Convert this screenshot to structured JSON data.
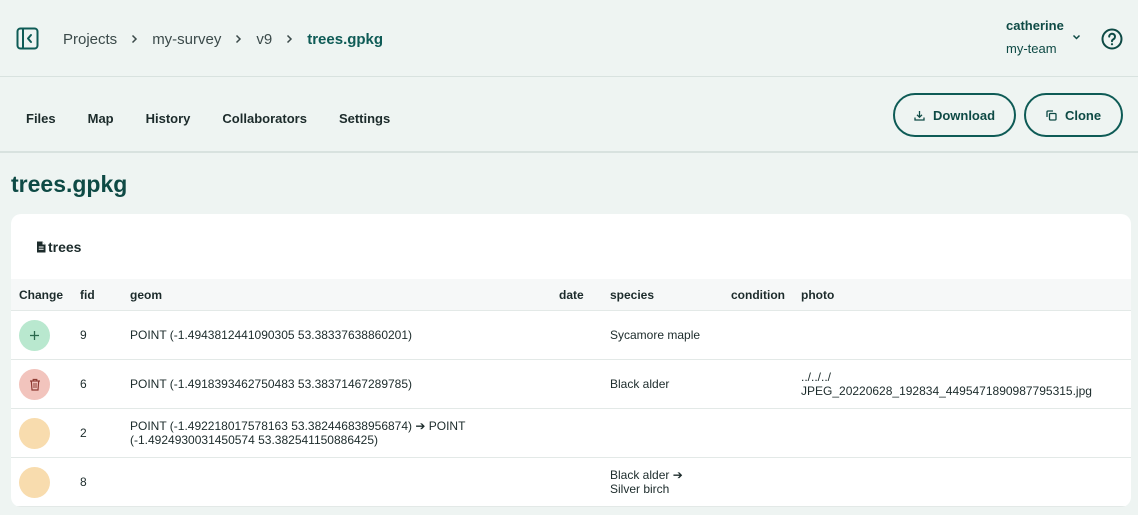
{
  "breadcrumb": {
    "items": [
      "Projects",
      "my-survey",
      "v9"
    ],
    "current": "trees.gpkg"
  },
  "user": {
    "name": "catherine",
    "team": "my-team"
  },
  "tabs": [
    "Files",
    "Map",
    "History",
    "Collaborators",
    "Settings"
  ],
  "actions": {
    "download": "Download",
    "clone": "Clone"
  },
  "page_title": "trees.gpkg",
  "layer": {
    "name": "trees"
  },
  "table": {
    "columns": [
      "Change",
      "fid",
      "geom",
      "date",
      "species",
      "condition",
      "photo"
    ],
    "rows": [
      {
        "change": "added",
        "fid": "9",
        "geom": "POINT (-1.4943812441090305 53.38337638860201)",
        "date": "",
        "species": "Sycamore maple",
        "condition": "",
        "photo": ""
      },
      {
        "change": "removed",
        "fid": "6",
        "geom": "POINT (-1.4918393462750483 53.38371467289785)",
        "date": "",
        "species": "Black alder",
        "condition": "",
        "photo": "../../../ JPEG_20220628_192834_4495471890987795315.jpg"
      },
      {
        "change": "updated",
        "fid": "2",
        "geom": "POINT (-1.492218017578163 53.382446838956874) ➔ POINT (-1.4924930031450574 53.382541150886425)",
        "date": "",
        "species": "",
        "condition": "",
        "photo": ""
      },
      {
        "change": "updated",
        "fid": "8",
        "geom": "",
        "date": "",
        "species": "Black alder ➔ Silver birch",
        "condition": "",
        "photo": ""
      }
    ]
  },
  "colors": {
    "accent": "#0e5b56",
    "background": "#eef4f2",
    "added": "#b9e8cf",
    "removed": "#f2c4bd",
    "updated": "#f8dcae"
  },
  "icons": {
    "sidebar_toggle": "sidebar-collapse-icon",
    "help": "help-circle-icon",
    "download": "download-icon",
    "clone": "copy-icon",
    "layer": "file-icon",
    "added": "plus-icon",
    "removed": "trash-icon"
  }
}
